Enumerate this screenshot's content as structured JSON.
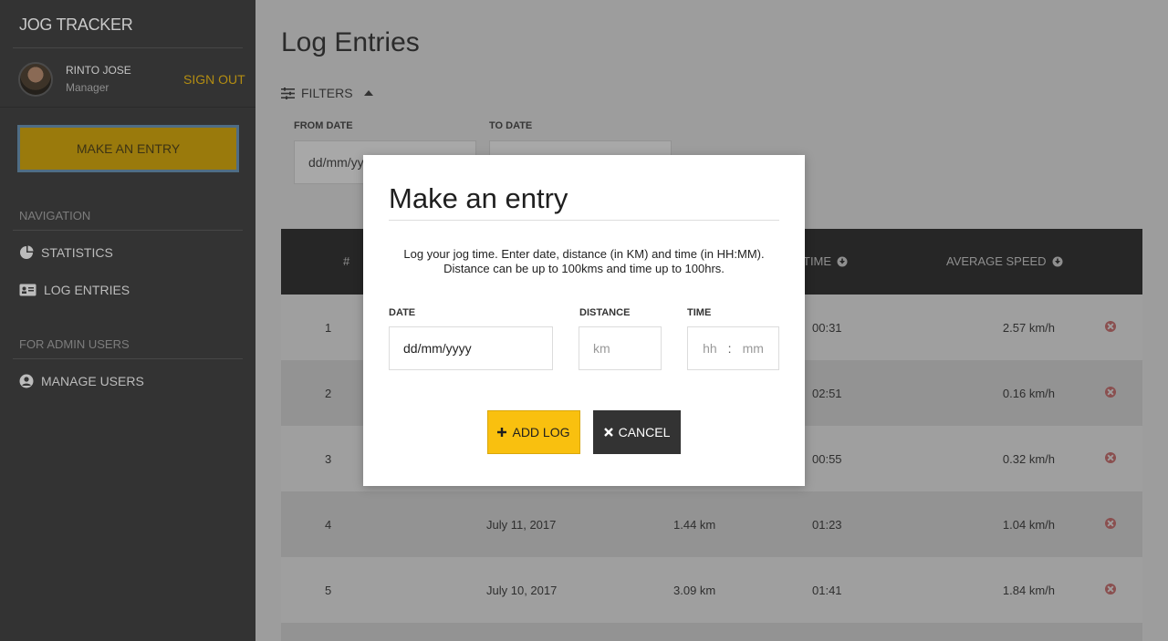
{
  "app": {
    "brand": "JOG TRACKER"
  },
  "user": {
    "name": "RINTO JOSE",
    "role": "Manager",
    "signout_label": "SIGN OUT"
  },
  "sidebar": {
    "make_entry_label": "MAKE AN ENTRY",
    "nav_title": "NAVIGATION",
    "nav_items": [
      {
        "label": "STATISTICS",
        "icon": "pie-chart-icon"
      },
      {
        "label": "LOG ENTRIES",
        "icon": "id-card-icon"
      }
    ],
    "admin_title": "FOR ADMIN USERS",
    "admin_items": [
      {
        "label": "MANAGE USERS",
        "icon": "user-circle-icon"
      }
    ]
  },
  "main": {
    "title": "Log Entries",
    "filters_label": "FILTERS",
    "from_date_label": "FROM DATE",
    "from_date_value": "dd/mm/yyyy",
    "to_date_label": "TO DATE",
    "to_date_value": ""
  },
  "table": {
    "headers": {
      "num": "#",
      "time": "TIME",
      "speed": "AVERAGE SPEED"
    },
    "rows": [
      {
        "num": "1",
        "date": "",
        "distance": "",
        "time": "00:31",
        "speed": "2.57 km/h"
      },
      {
        "num": "2",
        "date": "",
        "distance": "",
        "time": "02:51",
        "speed": "0.16 km/h"
      },
      {
        "num": "3",
        "date": "",
        "distance": "",
        "time": "00:55",
        "speed": "0.32 km/h"
      },
      {
        "num": "4",
        "date": "July 11, 2017",
        "distance": "1.44 km",
        "time": "01:23",
        "speed": "1.04 km/h"
      },
      {
        "num": "5",
        "date": "July 10, 2017",
        "distance": "3.09 km",
        "time": "01:41",
        "speed": "1.84 km/h"
      }
    ]
  },
  "modal": {
    "title": "Make an entry",
    "description_line1": "Log your jog time. Enter date, distance (in KM) and time (in HH:MM).",
    "description_line2": "Distance can be up to 100kms and time up to 100hrs.",
    "date_label": "DATE",
    "date_value": "dd/mm/yyyy",
    "distance_label": "DISTANCE",
    "distance_placeholder": "km",
    "time_label": "TIME",
    "hh_placeholder": "hh",
    "colon": ":",
    "mm_placeholder": "mm",
    "add_label": "ADD LOG",
    "cancel_label": "CANCEL"
  },
  "colors": {
    "accent": "#f9c00f",
    "sidebar": "#333333",
    "header": "#262626",
    "danger": "#e05555"
  }
}
